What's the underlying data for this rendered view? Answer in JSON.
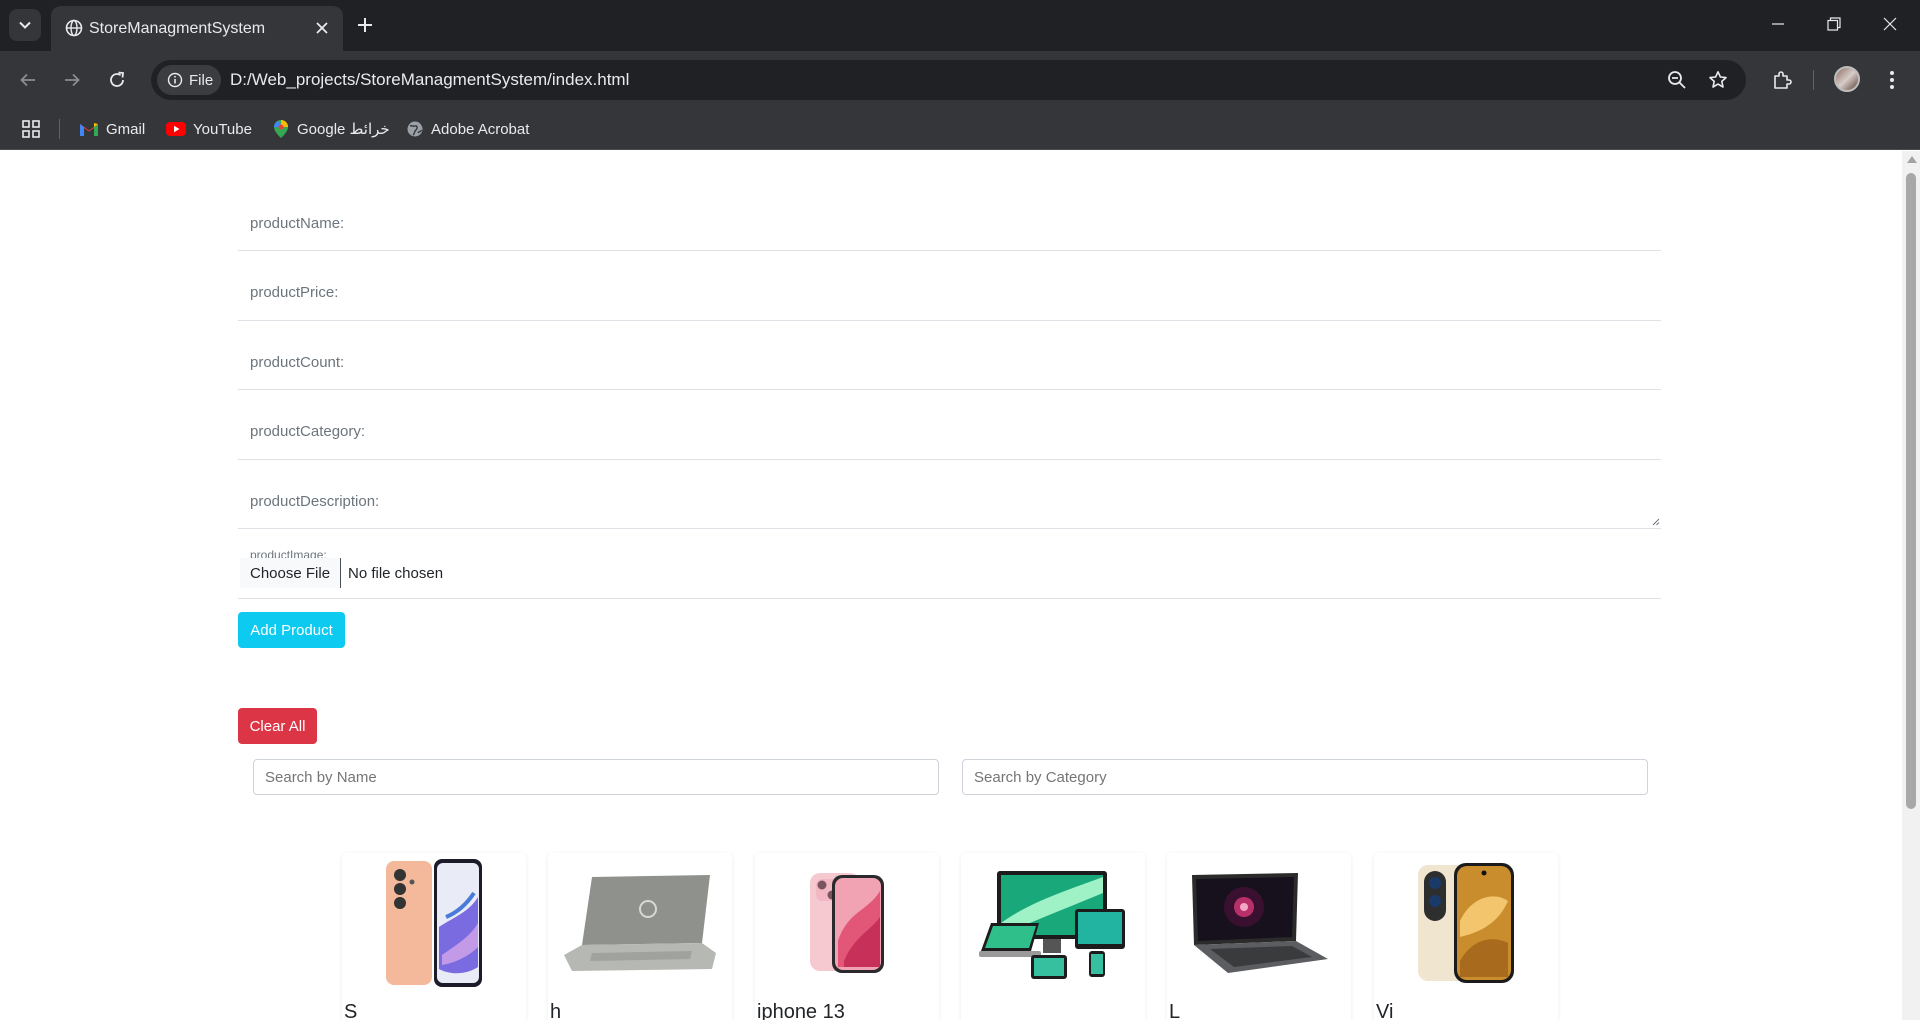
{
  "browser": {
    "tab_title": "StoreManagmentSystem",
    "site_chip": "File",
    "url": "D:/Web_projects/StoreManagmentSystem/index.html",
    "bookmarks": [
      {
        "label": "Gmail",
        "icon": "gmail-icon"
      },
      {
        "label": "YouTube",
        "icon": "youtube-icon"
      },
      {
        "label": "Google خرائط",
        "icon": "google-maps-icon"
      },
      {
        "label": "Adobe Acrobat",
        "icon": "globe-icon"
      }
    ]
  },
  "form": {
    "fields": [
      {
        "label": "productName:"
      },
      {
        "label": "productPrice:"
      },
      {
        "label": "productCount:"
      },
      {
        "label": "productCategory:"
      },
      {
        "label": "productDescription:"
      }
    ],
    "image": {
      "label": "productImage:",
      "button": "Choose File",
      "status": "No file chosen"
    },
    "add_button": "Add Product"
  },
  "clear_button": "Clear All",
  "search": {
    "by_name_placeholder": "Search by Name",
    "by_category_placeholder": "Search by Category"
  },
  "products": [
    {
      "name": "S",
      "image": "orange-smartphone"
    },
    {
      "name": "h",
      "image": "silver-laptop"
    },
    {
      "name": "iphone 13",
      "image": "pink-iphone"
    },
    {
      "name": "",
      "image": "device-set"
    },
    {
      "name": "L",
      "image": "gaming-laptop"
    },
    {
      "name": "Vi",
      "image": "gold-smartphone"
    }
  ],
  "colors": {
    "add_button": "#0dcaf0",
    "clear_button": "#dc3545",
    "chrome_dark": "#202124",
    "chrome_toolbar": "#35363a"
  }
}
